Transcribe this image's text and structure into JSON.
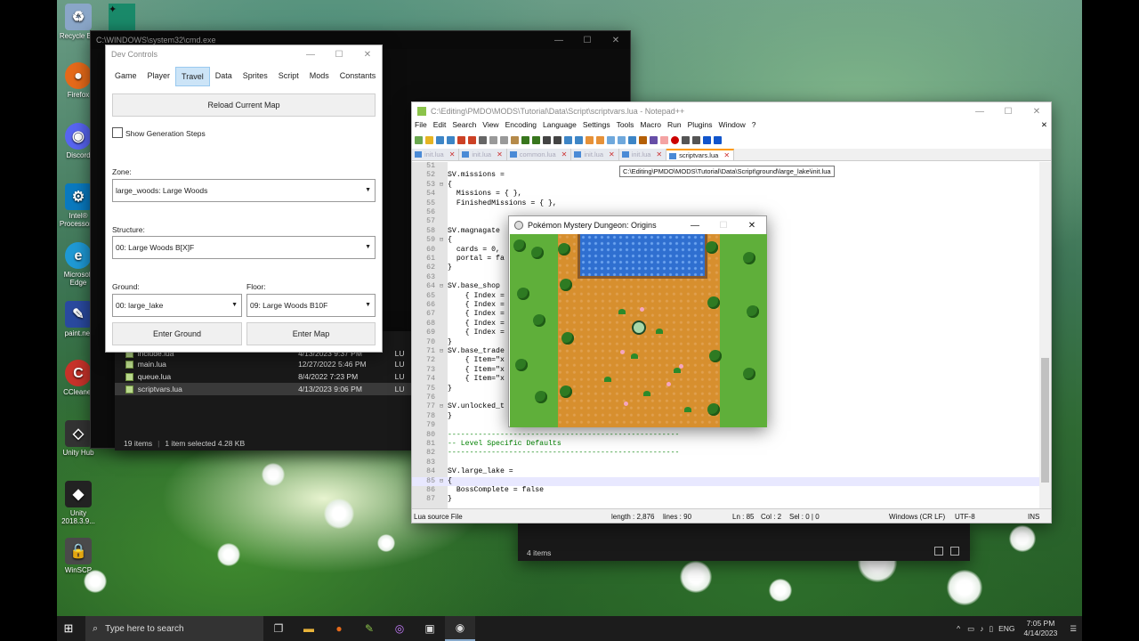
{
  "desktop_icons": [
    {
      "label": "Recycle Bin",
      "icon": "recycle-bin-icon"
    },
    {
      "label": "Firefox",
      "icon": "firefox-icon"
    },
    {
      "label": "Discord",
      "icon": "discord-icon"
    },
    {
      "label": "Intel® Processor...",
      "icon": "intel-icon"
    },
    {
      "label": "Microsoft Edge",
      "icon": "edge-icon"
    },
    {
      "label": "paint.net",
      "icon": "paintnet-icon"
    },
    {
      "label": "CCleaner",
      "icon": "ccleaner-icon"
    },
    {
      "label": "Unity Hub",
      "icon": "unity-hub-icon"
    },
    {
      "label": "Unity 2018.3.9...",
      "icon": "unity-icon"
    },
    {
      "label": "WinSCP",
      "icon": "winscp-icon"
    }
  ],
  "cmd": {
    "title": "C:\\WINDOWS\\system32\\cmd.exe"
  },
  "explorer": {
    "files": [
      {
        "name": "include.lua",
        "date": "4/13/2023 9:37 PM",
        "ext": "LU"
      },
      {
        "name": "main.lua",
        "date": "12/27/2022 5:46 PM",
        "ext": "LU"
      },
      {
        "name": "queue.lua",
        "date": "8/4/2022 7:23 PM",
        "ext": "LU"
      },
      {
        "name": "scriptvars.lua",
        "date": "4/13/2023 9:06 PM",
        "ext": "LU"
      }
    ],
    "status_count": "19 items",
    "status_selected": "1 item selected  4.28 KB"
  },
  "explorer2": {
    "status_count": "4 items"
  },
  "dev": {
    "title": "Dev Controls",
    "tabs": [
      "Game",
      "Player",
      "Travel",
      "Data",
      "Sprites",
      "Script",
      "Mods",
      "Constants"
    ],
    "active_tab": "Travel",
    "reload_button": "Reload Current Map",
    "show_steps_label": "Show Generation Steps",
    "zone_label": "Zone:",
    "zone_value": "large_woods: Large Woods",
    "structure_label": "Structure:",
    "structure_value": "00: Large Woods B[X]F",
    "ground_label": "Ground:",
    "ground_value": "00: large_lake",
    "floor_label": "Floor:",
    "floor_value": "09: Large Woods B10F",
    "enter_ground": "Enter Ground",
    "enter_map": "Enter Map"
  },
  "npp": {
    "title": "C:\\Editing\\PMDO\\MODS\\Tutorial\\Data\\Script\\scriptvars.lua - Notepad++",
    "menu": [
      "File",
      "Edit",
      "Search",
      "View",
      "Encoding",
      "Language",
      "Settings",
      "Tools",
      "Macro",
      "Run",
      "Plugins",
      "Window",
      "?"
    ],
    "tabs": [
      "init.lua",
      "init.lua",
      "common.lua",
      "init.lua",
      "init.lua",
      "scriptvars.lua"
    ],
    "active_tab": "scriptvars.lua",
    "tooltip": "C:\\Editing\\PMDO\\MODS\\Tutorial\\Data\\Script\\ground\\large_lake\\init.lua",
    "code": [
      {
        "n": "51",
        "f": "",
        "t": ""
      },
      {
        "n": "52",
        "f": "",
        "t": "SV.missions ="
      },
      {
        "n": "53",
        "f": "⊟",
        "t": "{"
      },
      {
        "n": "54",
        "f": "",
        "t": "  Missions = { },"
      },
      {
        "n": "55",
        "f": "",
        "t": "  FinishedMissions = { },"
      },
      {
        "n": "56",
        "f": "",
        "t": ""
      },
      {
        "n": "57",
        "f": "",
        "t": ""
      },
      {
        "n": "58",
        "f": "",
        "t": "SV.magnagate"
      },
      {
        "n": "59",
        "f": "⊟",
        "t": "{"
      },
      {
        "n": "60",
        "f": "",
        "t": "  cards = 0,"
      },
      {
        "n": "61",
        "f": "",
        "t": "  portal = fa"
      },
      {
        "n": "62",
        "f": "",
        "t": "}"
      },
      {
        "n": "63",
        "f": "",
        "t": ""
      },
      {
        "n": "64",
        "f": "⊟",
        "t": "SV.base_shop"
      },
      {
        "n": "65",
        "f": "",
        "t": "    { Index ="
      },
      {
        "n": "66",
        "f": "",
        "t": "    { Index ="
      },
      {
        "n": "67",
        "f": "",
        "t": "    { Index ="
      },
      {
        "n": "68",
        "f": "",
        "t": "    { Index ="
      },
      {
        "n": "69",
        "f": "",
        "t": "    { Index ="
      },
      {
        "n": "70",
        "f": "",
        "t": "}"
      },
      {
        "n": "71",
        "f": "⊟",
        "t": "SV.base_trade"
      },
      {
        "n": "72",
        "f": "",
        "t": "    { Item=\"x"
      },
      {
        "n": "73",
        "f": "",
        "t": "    { Item=\"x"
      },
      {
        "n": "74",
        "f": "",
        "t": "    { Item=\"x"
      },
      {
        "n": "75",
        "f": "",
        "t": "}"
      },
      {
        "n": "76",
        "f": "",
        "t": ""
      },
      {
        "n": "77",
        "f": "⊟",
        "t": "SV.unlocked_t"
      },
      {
        "n": "78",
        "f": "",
        "t": "}"
      },
      {
        "n": "79",
        "f": "",
        "t": ""
      },
      {
        "n": "80",
        "f": "",
        "t": "-----------------------------------------------------",
        "c": true
      },
      {
        "n": "81",
        "f": "",
        "t": "-- Level Specific Defaults",
        "c": true
      },
      {
        "n": "82",
        "f": "",
        "t": "-----------------------------------------------------",
        "c": true
      },
      {
        "n": "83",
        "f": "",
        "t": ""
      },
      {
        "n": "84",
        "f": "",
        "t": "SV.large_lake ="
      },
      {
        "n": "85",
        "f": "⊟",
        "t": "{",
        "cur": true
      },
      {
        "n": "86",
        "f": "",
        "t": "  BossComplete = false"
      },
      {
        "n": "87",
        "f": "",
        "t": "}"
      }
    ],
    "status": {
      "type": "Lua source File",
      "length": "length : 2,876",
      "lines": "lines : 90",
      "ln": "Ln : 85",
      "col": "Col : 2",
      "sel": "Sel : 0 | 0",
      "eol": "Windows (CR LF)",
      "enc": "UTF-8",
      "ins": "INS"
    }
  },
  "game": {
    "title": "Pokémon Mystery Dungeon: Origins"
  },
  "taskbar": {
    "search_placeholder": "Type here to search",
    "lang": "ENG",
    "time": "7:05 PM",
    "date": "4/14/2023"
  },
  "colors": {
    "accent": "#0078d7",
    "dev_tab_active": "#cce4f7",
    "npp_active_tab": "#ff9900"
  }
}
